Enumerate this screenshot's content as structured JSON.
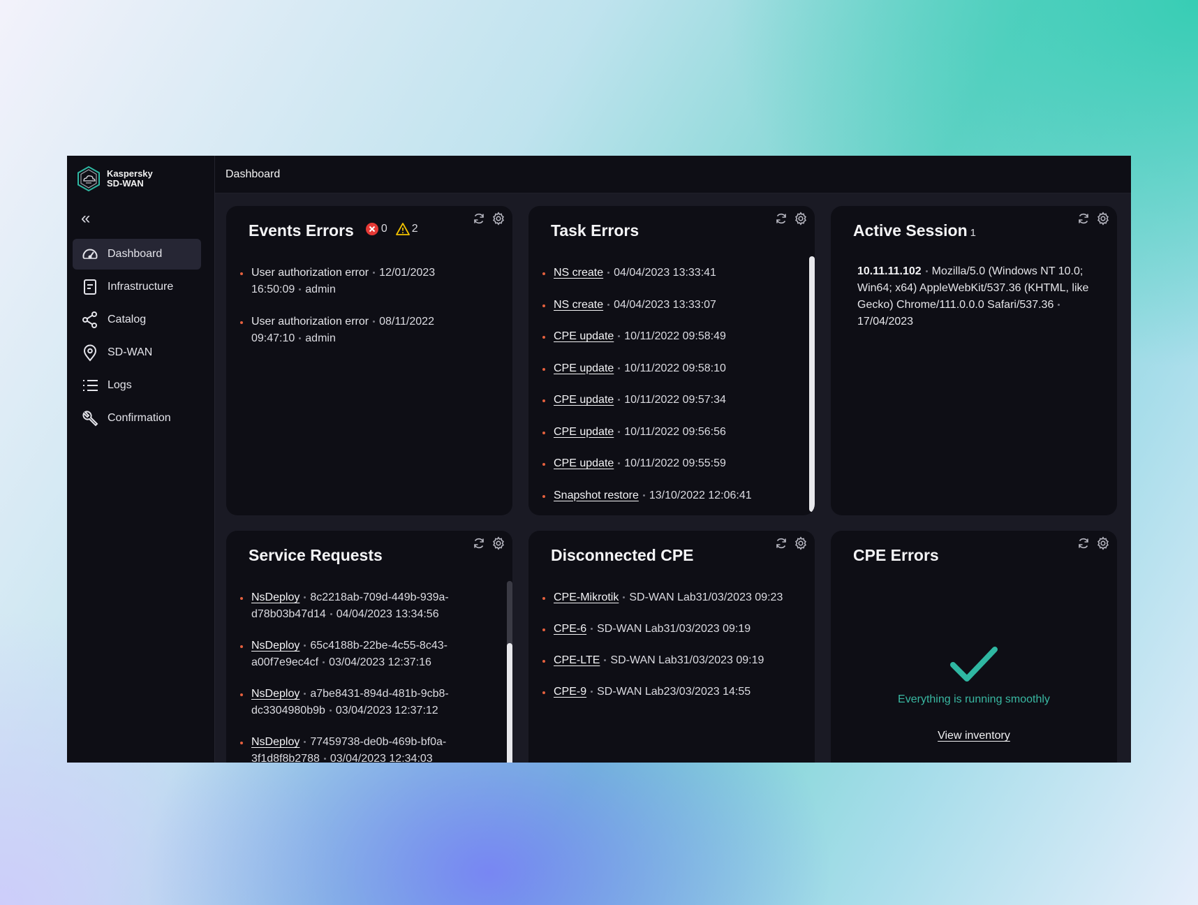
{
  "brand": {
    "line1": "Kaspersky",
    "line2": "SD-WAN"
  },
  "collapse_glyph": "«",
  "nav": [
    {
      "label": "Dashboard",
      "icon": "gauge-icon",
      "active": true
    },
    {
      "label": "Infrastructure",
      "icon": "document-icon"
    },
    {
      "label": "Catalog",
      "icon": "share-icon"
    },
    {
      "label": "SD-WAN",
      "icon": "location-pin-icon"
    },
    {
      "label": "Logs",
      "icon": "list-icon"
    },
    {
      "label": "Confirmation",
      "icon": "wrench-icon"
    }
  ],
  "topbar": {
    "title": "Dashboard"
  },
  "events_errors": {
    "title": "Events Errors",
    "error_count": "0",
    "warning_count": "2",
    "items": [
      {
        "name": "User authorization error",
        "date": "12/01/2023",
        "time": "16:50:09",
        "user": "admin"
      },
      {
        "name": "User authorization error",
        "date": "08/11/2022",
        "time": "09:47:10",
        "user": "admin"
      }
    ]
  },
  "task_errors": {
    "title": "Task Errors",
    "items": [
      {
        "name": "NS create",
        "time": "04/04/2023 13:33:41"
      },
      {
        "name": "NS create",
        "time": "04/04/2023 13:33:07"
      },
      {
        "name": "CPE update",
        "time": "10/11/2022 09:58:49"
      },
      {
        "name": "CPE update",
        "time": "10/11/2022 09:58:10"
      },
      {
        "name": "CPE update",
        "time": "10/11/2022 09:57:34"
      },
      {
        "name": "CPE update",
        "time": "10/11/2022 09:56:56"
      },
      {
        "name": "CPE update",
        "time": "10/11/2022 09:55:59"
      },
      {
        "name": "Snapshot restore",
        "time": "13/10/2022 12:06:41"
      }
    ]
  },
  "active_session": {
    "title": "Active Session",
    "count": "1",
    "ip": "10.11.11.102",
    "agent": "Mozilla/5.0 (Windows NT 10.0; Win64; x64) AppleWebKit/537.36 (KHTML, like Gecko) Chrome/111.0.0.0 Safari/537.36",
    "date": "17/04/2023"
  },
  "service_requests": {
    "title": "Service Requests",
    "items": [
      {
        "name": "NsDeploy",
        "id_a": "8c2218ab-709d-449b-939a-",
        "id_b": "d78b03b47d14",
        "time": "04/04/2023 13:34:56"
      },
      {
        "name": "NsDeploy",
        "id_a": "65c4188b-22be-4c55-8c43-",
        "id_b": "a00f7e9ec4cf",
        "time": "03/04/2023 12:37:16"
      },
      {
        "name": "NsDeploy",
        "id_a": "a7be8431-894d-481b-9cb8-",
        "id_b": "dc3304980b9b",
        "time": "03/04/2023 12:37:12"
      },
      {
        "name": "NsDeploy",
        "id_a": "77459738-de0b-469b-bf0a-",
        "id_b": "3f1d8f8b2788",
        "time": "03/04/2023 12:34:03"
      }
    ]
  },
  "disconnected_cpe": {
    "title": "Disconnected CPE",
    "items": [
      {
        "name": "CPE-Mikrotik",
        "location": "SD-WAN Lab",
        "time": "31/03/2023 09:23"
      },
      {
        "name": "CPE-6",
        "location": "SD-WAN Lab",
        "time": "31/03/2023 09:19"
      },
      {
        "name": "CPE-LTE",
        "location": "SD-WAN Lab",
        "time": "31/03/2023 09:19"
      },
      {
        "name": "CPE-9",
        "location": "SD-WAN Lab",
        "time": "23/03/2023 14:55"
      }
    ]
  },
  "cpe_errors": {
    "title": "CPE Errors",
    "status_text": "Everything is running smoothly",
    "link_label": "View inventory"
  },
  "colors": {
    "accent_teal": "#39b8a2",
    "bullet_orange": "#e5603e",
    "error_red": "#e53935",
    "warning_yellow": "#f2c200"
  }
}
